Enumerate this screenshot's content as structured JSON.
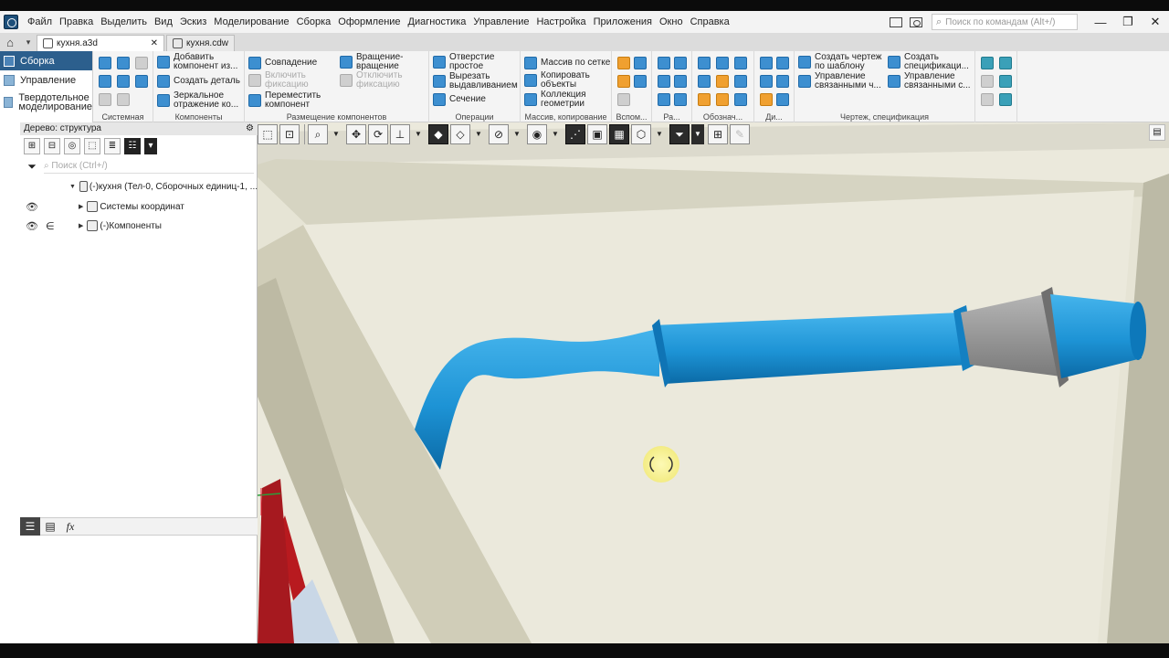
{
  "menubar": {
    "items": [
      "Файл",
      "Правка",
      "Выделить",
      "Вид",
      "Эскиз",
      "Моделирование",
      "Сборка",
      "Оформление",
      "Диагностика",
      "Управление",
      "Настройка",
      "Приложения",
      "Окно",
      "Справка"
    ],
    "search_placeholder": "Поиск по командам (Alt+/)"
  },
  "tabs": [
    {
      "label": "кухня.a3d",
      "close": "✕"
    },
    {
      "label": "кухня.cdw"
    }
  ],
  "ribbon": {
    "modes": [
      "Сборка",
      "Управление",
      "Твердотельное",
      "моделирование"
    ],
    "groups": {
      "system": "Системная",
      "components": "Компоненты",
      "placement": "Размещение компонентов",
      "operations": "Операции",
      "array": "Массив, копирование",
      "aux": "Вспом...",
      "sizes": "Ра...",
      "notation": "Обознач...",
      "di": "Ди...",
      "drawing": "Чертеж, спецификация"
    },
    "buttons": {
      "add_component": [
        "Добавить",
        "компонент из..."
      ],
      "create_part": "Создать деталь",
      "mirror": [
        "Зеркальное",
        "отражение ко..."
      ],
      "coincidence": "Совпадение",
      "enable_fix": [
        "Включить",
        "фиксацию"
      ],
      "move_component": [
        "Переместить",
        "компонент"
      ],
      "rotate": [
        "Вращение-",
        "вращение"
      ],
      "disable_fix": [
        "Отключить",
        "фиксацию"
      ],
      "simple_hole": [
        "Отверстие",
        "простое"
      ],
      "cut_extrude": [
        "Вырезать",
        "выдавливанием"
      ],
      "section": "Сечение",
      "grid_array": "Массив по сетке",
      "copy_objects": [
        "Копировать",
        "объекты"
      ],
      "geometry_collection": [
        "Коллекция",
        "геометрии"
      ],
      "drawing_template": [
        "Создать чертеж",
        "по шаблону"
      ],
      "manage_linked_1": [
        "Управление",
        "связанными ч..."
      ],
      "create_spec": [
        "Создать",
        "спецификаци..."
      ],
      "manage_linked_2": [
        "Управление",
        "связанными с..."
      ]
    }
  },
  "tree": {
    "title": "Дерево: структура",
    "filter_placeholder": "Поиск (Ctrl+/)",
    "rows": [
      {
        "label": "(-)кухня (Тел-0, Сборочных единиц-1, ..."
      },
      {
        "label": "Системы координат"
      },
      {
        "label": "(-)Компоненты"
      }
    ],
    "fx": "fx"
  },
  "colors": {
    "ribbon_active": "#2c5f8d",
    "viewport_bg": "#ebe9dc",
    "duct": "#1e93d6",
    "transition": "#8f8f8f",
    "frame": "#c0161c"
  }
}
